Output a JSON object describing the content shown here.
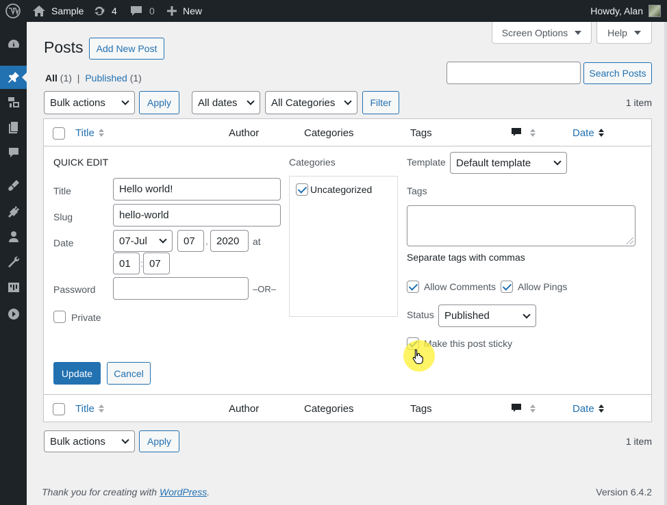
{
  "adminbar": {
    "site_name": "Sample",
    "updates_count": "4",
    "comments_count": "0",
    "new_label": "New",
    "howdy": "Howdy, Alan"
  },
  "sidebar": {
    "items": [
      {
        "icon": "dashboard-icon"
      },
      {
        "icon": "posts-pin-icon",
        "active": true
      },
      {
        "icon": "media-icon"
      },
      {
        "icon": "pages-icon"
      },
      {
        "icon": "comments-icon"
      },
      {
        "icon": "appearance-icon"
      },
      {
        "icon": "plugins-icon"
      },
      {
        "icon": "users-icon"
      },
      {
        "icon": "tools-icon"
      },
      {
        "icon": "settings-icon"
      },
      {
        "icon": "collapse-menu-icon"
      }
    ]
  },
  "header": {
    "screen_options": "Screen Options",
    "help": "Help",
    "title": "Posts",
    "add_new": "Add New Post"
  },
  "views": {
    "all_label": "All",
    "all_count": "(1)",
    "separator": "|",
    "published_label": "Published",
    "published_count": "(1)"
  },
  "search": {
    "value": "",
    "button": "Search Posts"
  },
  "tablenav_top": {
    "bulk_actions": "Bulk actions",
    "apply": "Apply",
    "dates": "All dates",
    "categories": "All Categories",
    "filter": "Filter",
    "items": "1 item"
  },
  "columns": {
    "title": "Title",
    "author": "Author",
    "categories": "Categories",
    "tags": "Tags",
    "date": "Date"
  },
  "quick_edit": {
    "heading": "QUICK EDIT",
    "title_label": "Title",
    "title_value": "Hello world!",
    "slug_label": "Slug",
    "slug_value": "hello-world",
    "date_label": "Date",
    "month": "07-Jul",
    "day": "07",
    "comma": ",",
    "year": "2020",
    "at": "at",
    "hour": "01",
    "colon": ":",
    "minute": "07",
    "password_label": "Password",
    "password_value": "",
    "or": "–OR–",
    "private_label": "Private",
    "categories_label": "Categories",
    "category_item": "Uncategorized",
    "template_label": "Template",
    "template_value": "Default template",
    "tags_label": "Tags",
    "tags_value": "",
    "tags_hint": "Separate tags with commas",
    "allow_comments": "Allow Comments",
    "allow_pings": "Allow Pings",
    "status_label": "Status",
    "status_value": "Published",
    "sticky_label": "Make this post sticky",
    "update": "Update",
    "cancel": "Cancel"
  },
  "tablenav_bottom": {
    "bulk_actions": "Bulk actions",
    "apply": "Apply",
    "items": "1 item"
  },
  "footer": {
    "thanks_prefix": "Thank you for creating with ",
    "thanks_link": "WordPress",
    "thanks_suffix": ".",
    "version": "Version 6.4.2"
  },
  "colors": {
    "accent": "#2271b1",
    "adminbar_bg": "#1d2327",
    "page_bg": "#f0f0f1"
  }
}
